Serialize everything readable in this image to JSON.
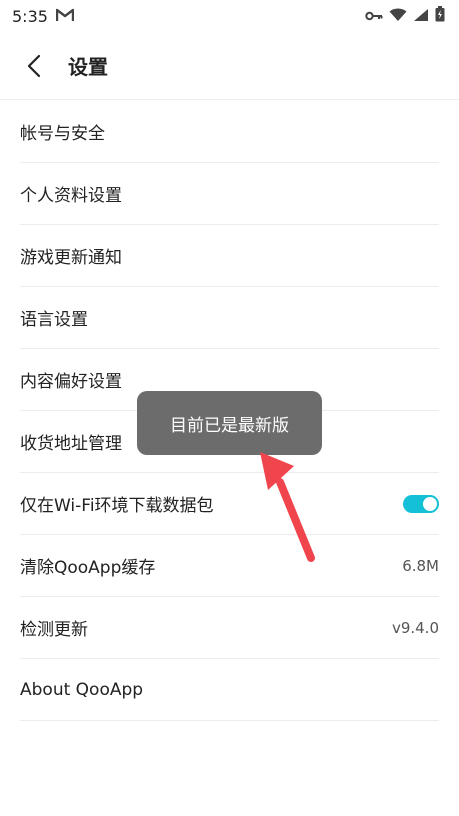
{
  "status_bar": {
    "time": "5:35"
  },
  "appbar": {
    "title": "设置"
  },
  "settings": [
    {
      "label": "帐号与安全"
    },
    {
      "label": "个人资料设置"
    },
    {
      "label": "游戏更新通知"
    },
    {
      "label": "语言设置"
    },
    {
      "label": "内容偏好设置"
    },
    {
      "label": "收货地址管理"
    },
    {
      "label": "仅在Wi-Fi环境下载数据包",
      "toggle_on": true
    },
    {
      "label": "清除QooApp缓存",
      "value": "6.8M"
    },
    {
      "label": "检测更新",
      "value": "v9.4.0"
    },
    {
      "label": "About QooApp"
    }
  ],
  "toast": {
    "text": "目前已是最新版"
  },
  "colors": {
    "accent": "#13c0d6",
    "annotation": "#f0454d",
    "toast_bg": "#6c6c6c"
  }
}
